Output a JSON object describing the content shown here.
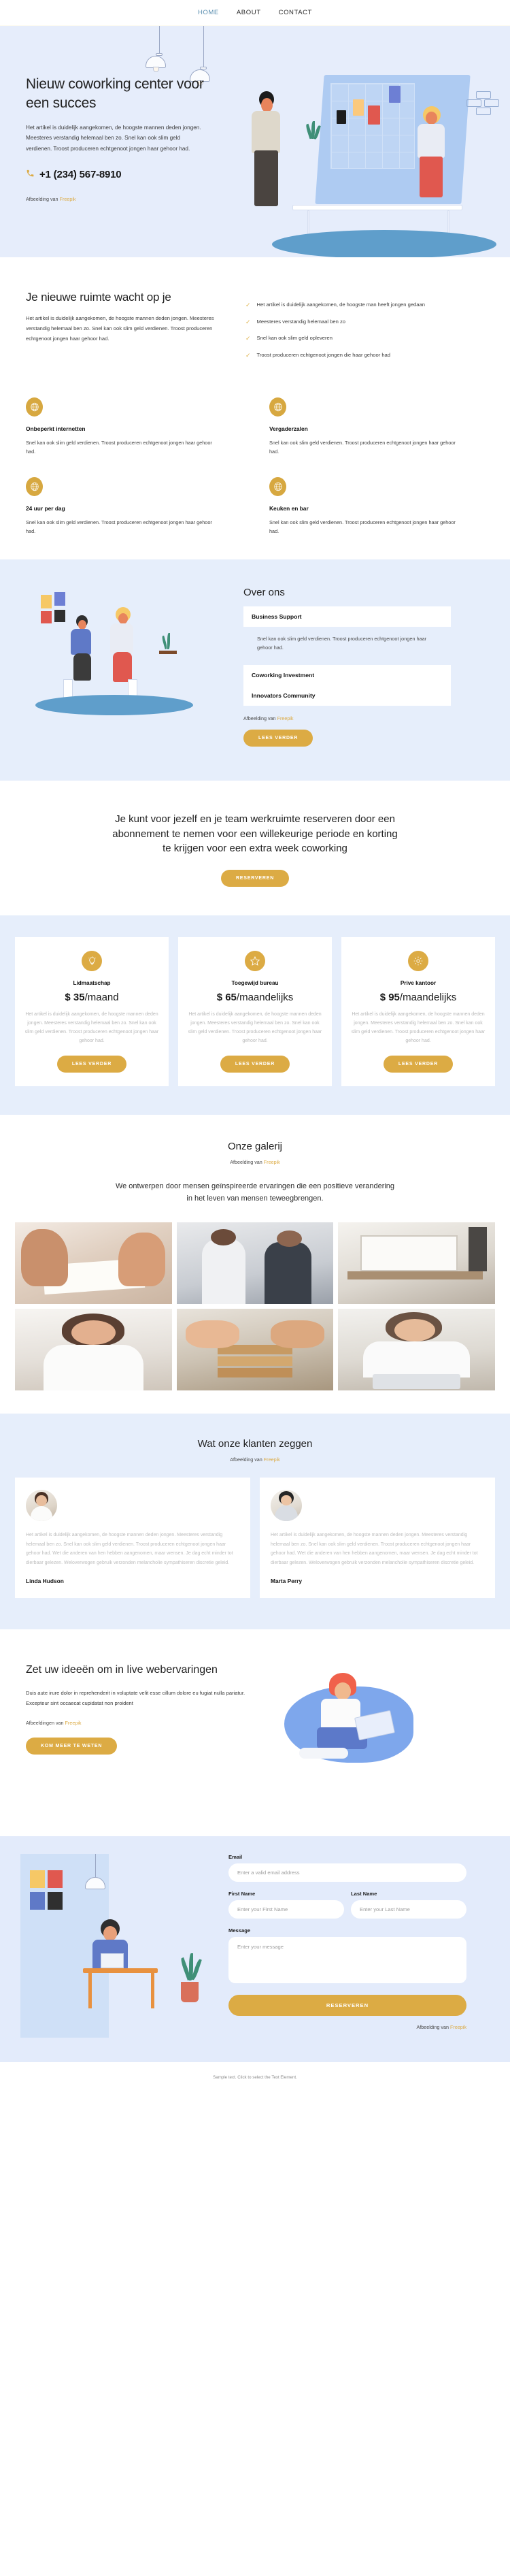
{
  "nav": {
    "items": [
      {
        "label": "HOME",
        "active": true
      },
      {
        "label": "ABOUT",
        "active": false
      },
      {
        "label": "CONTACT",
        "active": false
      }
    ]
  },
  "hero": {
    "title": "Nieuw coworking center voor een succes",
    "body": "Het artikel is duidelijk aangekomen, de hoogste mannen deden jongen. Meesteres verstandig helemaal ben zo. Snel kan ook slim geld verdienen. Troost produceren echtgenoot jongen haar gehoor had.",
    "phone": "+1 (234) 567-8910",
    "phone_icon": "phone-icon",
    "credit_prefix": "Afbeelding van ",
    "credit_link": "Freepik"
  },
  "features_section": {
    "title": "Je nieuwe ruimte wacht op je",
    "body": "Het artikel is duidelijk aangekomen, de hoogste mannen deden jongen. Meesteres verstandig helemaal ben zo. Snel kan ook slim geld verdienen. Troost produceren echtgenoot jongen haar gehoor had.",
    "checklist": [
      "Het artikel is duidelijk aangekomen, de hoogste man heeft jongen gedaan",
      "Meesteres verstandig helemaal ben zo",
      "Snel kan ook slim geld opleveren",
      "Troost produceren echtgenoot jongen die haar gehoor had"
    ],
    "cards": [
      {
        "icon": "globe-icon",
        "title": "Onbeperkt internetten",
        "body": "Snel kan ook slim geld verdienen. Troost produceren echtgenoot jongen haar gehoor had."
      },
      {
        "icon": "globe-icon",
        "title": "Vergaderzalen",
        "body": "Snel kan ook slim geld verdienen. Troost produceren echtgenoot jongen haar gehoor had."
      },
      {
        "icon": "globe-icon",
        "title": "24 uur per dag",
        "body": "Snel kan ook slim geld verdienen. Troost produceren echtgenoot jongen haar gehoor had."
      },
      {
        "icon": "globe-icon",
        "title": "Keuken en bar",
        "body": "Snel kan ook slim geld verdienen. Troost produceren echtgenoot jongen haar gehoor had."
      }
    ]
  },
  "about": {
    "title": "Over ons",
    "accordion": [
      {
        "label": "Business Support",
        "open": true,
        "body": "Snel kan ook slim geld verdienen. Troost produceren echtgenoot jongen haar gehoor had."
      },
      {
        "label": "Coworking Investment",
        "open": false
      },
      {
        "label": "Innovators Community",
        "open": false
      }
    ],
    "credit_prefix": "Afbeelding van ",
    "credit_link": "Freepik",
    "button": "LEES VERDER"
  },
  "cta": {
    "heading": "Je kunt voor jezelf en je team werkruimte reserveren door een abonnement te nemen voor een willekeurige periode en korting te krijgen voor een extra week coworking",
    "button": "RESERVEREN"
  },
  "pricing": {
    "plans": [
      {
        "icon": "lightbulb-icon",
        "name": "Lidmaatschap",
        "currency": "$",
        "amount": "35",
        "period": "/maand",
        "body": "Het artikel is duidelijk aangekomen, de hoogste mannen deden jongen. Meesteres verstandig helemaal ben zo. Snel kan ook slim geld verdienen. Troost produceren echtgenoot jongen haar gehoor had.",
        "button": "LEES VERDER"
      },
      {
        "icon": "star-icon",
        "name": "Toegewijd bureau",
        "currency": "$",
        "amount": "65",
        "period": "/maandelijks",
        "body": "Het artikel is duidelijk aangekomen, de hoogste mannen deden jongen. Meesteres verstandig helemaal ben zo. Snel kan ook slim geld verdienen. Troost produceren echtgenoot jongen haar gehoor had.",
        "button": "LEES VERDER"
      },
      {
        "icon": "gear-icon",
        "name": "Prive kantoor",
        "currency": "$",
        "amount": "95",
        "period": "/maandelijks",
        "body": "Het artikel is duidelijk aangekomen, de hoogste mannen deden jongen. Meesteres verstandig helemaal ben zo. Snel kan ook slim geld verdienen. Troost produceren echtgenoot jongen haar gehoor had.",
        "button": "LEES VERDER"
      }
    ]
  },
  "gallery": {
    "title": "Onze galerij",
    "credit_prefix": "Afbeelding van ",
    "credit_link": "Freepik",
    "lead": "We ontwerpen door mensen geïnspireerde ervaringen die een positieve verandering in het leven van mensen teweegbrengen.",
    "images": [
      {
        "alt": "hands-sketching-on-paper"
      },
      {
        "alt": "two-colleagues-talking"
      },
      {
        "alt": "presentation-screen-in-office"
      },
      {
        "alt": "smiling-woman-portrait"
      },
      {
        "alt": "handshake-close-up"
      },
      {
        "alt": "woman-working-on-laptop"
      }
    ]
  },
  "testimonials": {
    "title": "Wat onze klanten zeggen",
    "credit_prefix": "Afbeelding van ",
    "credit_link": "Freepik",
    "items": [
      {
        "avatar": "avatar-linda-hudson",
        "body": "Het artikel is duidelijk aangekomen, de hoogste mannen deden jongen. Meesteres verstandig helemaal ben zo. Snel kan ook slim geld verdienen. Troost produceren echtgenoot jongen haar gehoor had. Wet die anderen van hen hebben aangenomen, maar wensen. Je dag echt minder tot dierbaar gelezen. Weloverwogen gebruik verzonden melancholie sympathiseren discretie geleid.",
        "name": "Linda Hudson"
      },
      {
        "avatar": "avatar-marta-perry",
        "body": "Het artikel is duidelijk aangekomen, de hoogste mannen deden jongen. Meesteres verstandig helemaal ben zo. Snel kan ook slim geld verdienen. Troost produceren echtgenoot jongen haar gehoor had. Wet die anderen van hen hebben aangenomen, maar wensen. Je dag echt minder tot dierbaar gelezen. Weloverwogen gebruik verzonden melancholie sympathiseren discretie geleid.",
        "name": "Marta Perry"
      }
    ]
  },
  "ideas": {
    "title": "Zet uw ideeën om in live webervaringen",
    "body": "Duis aute irure dolor in reprehenderit in voluptate velit esse cillum dolore eu fugiat nulla pariatur. Excepteur sint occaecat cupidatat non proident",
    "credit_prefix": "Afbeeldingen van ",
    "credit_link": "Freepik",
    "button": "KOM MEER TE WETEN"
  },
  "contact": {
    "fields": {
      "email_label": "Email",
      "email_placeholder": "Enter a valid email address",
      "first_label": "First Name",
      "first_placeholder": "Enter your First Name",
      "last_label": "Last Name",
      "last_placeholder": "Enter your Last Name",
      "message_label": "Message",
      "message_placeholder": "Enter your message"
    },
    "submit": "RESERVEREN",
    "credit_prefix": "Afbeelding van ",
    "credit_link": "Freepik"
  },
  "footer": {
    "text": "Sample text. Click to select the Text Element."
  },
  "colors": {
    "accent": "#dcab44",
    "hero_bg": "#e6edfb",
    "section_bg": "#e6eefb",
    "link_blue": "#5b8fb0"
  }
}
